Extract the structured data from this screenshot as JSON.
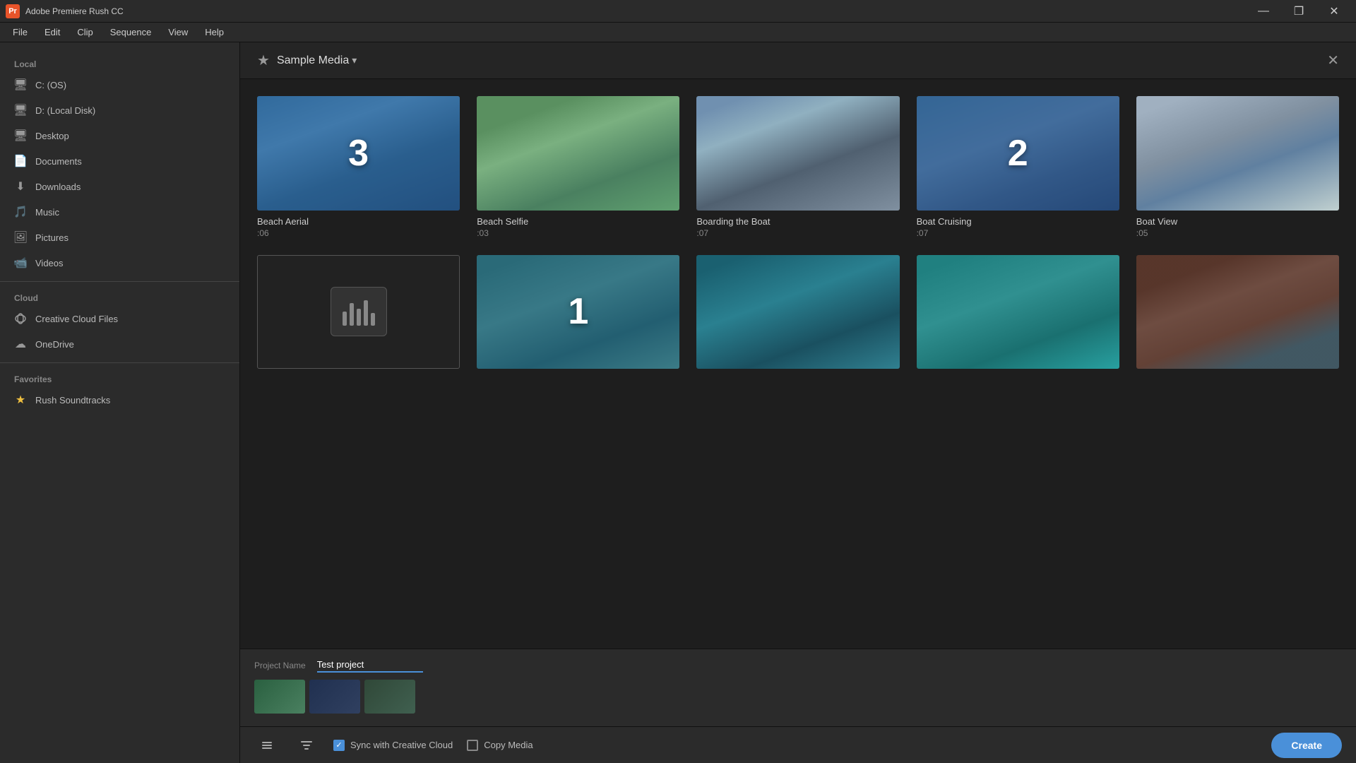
{
  "app": {
    "title": "Adobe Premiere Rush CC",
    "icon_label": "Pr"
  },
  "titlebar": {
    "minimize": "—",
    "maximize": "❐",
    "close": "✕"
  },
  "menubar": {
    "items": [
      "File",
      "Edit",
      "Clip",
      "Sequence",
      "View",
      "Help"
    ]
  },
  "sidebar": {
    "local_label": "Local",
    "local_items": [
      {
        "icon": "💻",
        "label": "C: (OS)"
      },
      {
        "icon": "💻",
        "label": "D: (Local Disk)"
      },
      {
        "icon": "🖥",
        "label": "Desktop"
      },
      {
        "icon": "📄",
        "label": "Documents"
      },
      {
        "icon": "⬇",
        "label": "Downloads"
      },
      {
        "icon": "🎵",
        "label": "Music"
      },
      {
        "icon": "🖼",
        "label": "Pictures"
      },
      {
        "icon": "📹",
        "label": "Videos"
      }
    ],
    "cloud_label": "Cloud",
    "cloud_items": [
      {
        "icon": "☁",
        "label": "Creative Cloud Files"
      },
      {
        "icon": "☁",
        "label": "OneDrive"
      }
    ],
    "favorites_label": "Favorites",
    "favorites_items": [
      {
        "label": "Rush Soundtracks"
      }
    ]
  },
  "content_header": {
    "star": "★",
    "title": "Sample Media",
    "dropdown": "▾",
    "close": "✕"
  },
  "media_items": [
    {
      "id": "beach-aerial",
      "title": "Beach Aerial",
      "duration": ":06",
      "number": "3",
      "thumb_class": "thumb-aerial",
      "has_overlay": true
    },
    {
      "id": "beach-selfie",
      "title": "Beach Selfie",
      "duration": ":03",
      "number": null,
      "thumb_class": "thumb-selfie",
      "has_overlay": false
    },
    {
      "id": "boarding-boat",
      "title": "Boarding the Boat",
      "duration": ":07",
      "number": null,
      "thumb_class": "thumb-boarding",
      "has_overlay": false
    },
    {
      "id": "boat-cruising",
      "title": "Boat Cruising",
      "duration": ":07",
      "number": "2",
      "thumb_class": "thumb-cruising",
      "has_overlay": true
    },
    {
      "id": "boat-view",
      "title": "Boat View",
      "duration": ":05",
      "number": null,
      "thumb_class": "thumb-boatview",
      "has_overlay": false
    },
    {
      "id": "audio-file",
      "title": "",
      "duration": "",
      "number": null,
      "thumb_class": "audio-thumb",
      "has_overlay": false,
      "is_audio": true
    },
    {
      "id": "aerial2",
      "title": "",
      "duration": "",
      "number": "1",
      "thumb_class": "thumb-aerial2",
      "has_overlay": true
    },
    {
      "id": "underwater1",
      "title": "",
      "duration": "",
      "number": null,
      "thumb_class": "thumb-underwater",
      "has_overlay": false
    },
    {
      "id": "underwater2",
      "title": "",
      "duration": "",
      "number": null,
      "thumb_class": "thumb-underwater2",
      "has_overlay": false
    },
    {
      "id": "portrait",
      "title": "",
      "duration": "",
      "number": null,
      "thumb_class": "thumb-portrait",
      "has_overlay": false
    }
  ],
  "project": {
    "name_label": "Project Name",
    "name_value": "Test project",
    "name_placeholder": "Test project"
  },
  "bottom_bar": {
    "sync_label": "Sync with Creative Cloud",
    "copy_label": "Copy Media",
    "create_label": "Create"
  }
}
